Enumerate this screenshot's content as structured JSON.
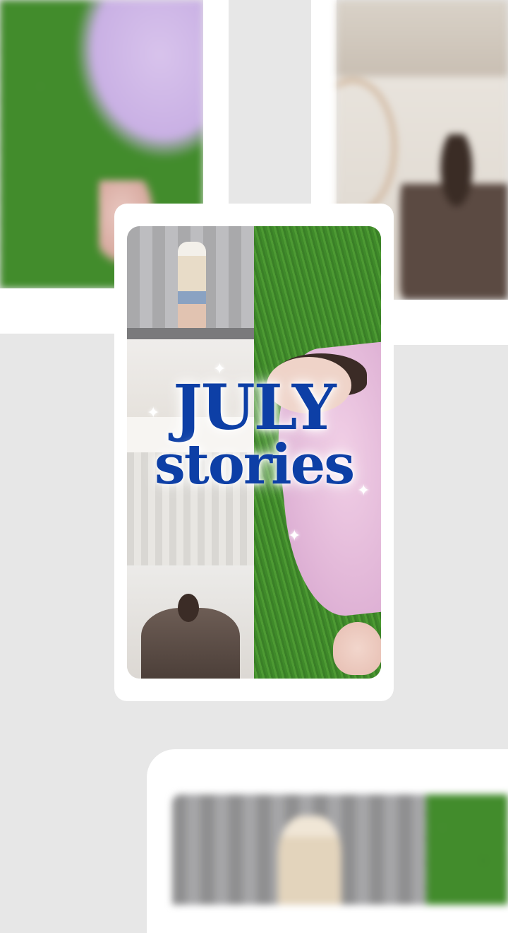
{
  "story": {
    "title_line1": "JULY",
    "title_line2": "stories"
  },
  "icons": {
    "sparkle": "✦"
  },
  "colors": {
    "title": "#0d3fa6",
    "background": "#e7e7e7",
    "card": "#ffffff"
  }
}
